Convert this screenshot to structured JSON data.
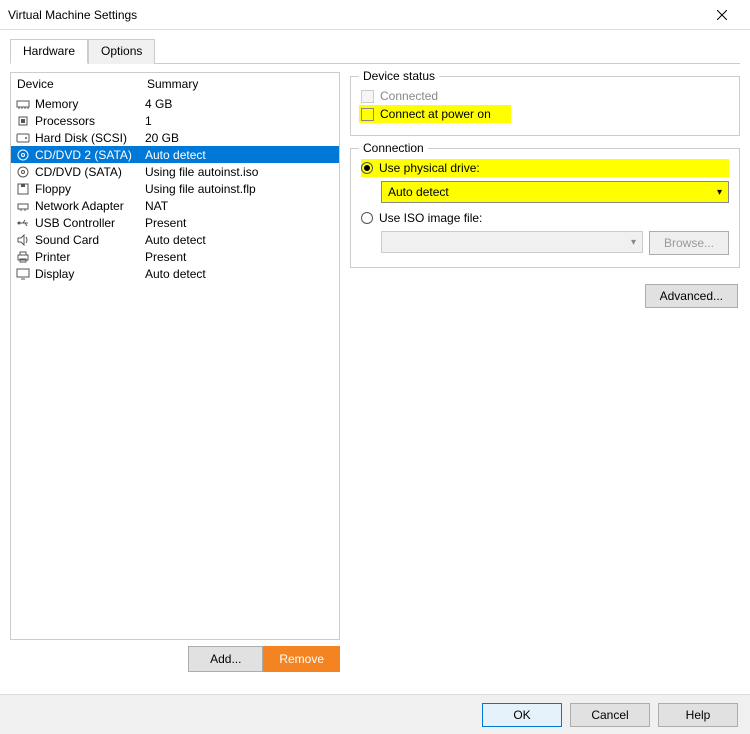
{
  "window": {
    "title": "Virtual Machine Settings"
  },
  "tabs": {
    "hardware": "Hardware",
    "options": "Options"
  },
  "listHeader": {
    "device": "Device",
    "summary": "Summary"
  },
  "devices": [
    {
      "icon": "memory",
      "name": "Memory",
      "summary": "4 GB"
    },
    {
      "icon": "cpu",
      "name": "Processors",
      "summary": "1"
    },
    {
      "icon": "disk",
      "name": "Hard Disk (SCSI)",
      "summary": "20 GB"
    },
    {
      "icon": "cd",
      "name": "CD/DVD 2 (SATA)",
      "summary": "Auto detect"
    },
    {
      "icon": "cd",
      "name": "CD/DVD (SATA)",
      "summary": "Using file autoinst.iso"
    },
    {
      "icon": "floppy",
      "name": "Floppy",
      "summary": "Using file autoinst.flp"
    },
    {
      "icon": "network",
      "name": "Network Adapter",
      "summary": "NAT"
    },
    {
      "icon": "usb",
      "name": "USB Controller",
      "summary": "Present"
    },
    {
      "icon": "sound",
      "name": "Sound Card",
      "summary": "Auto detect"
    },
    {
      "icon": "printer",
      "name": "Printer",
      "summary": "Present"
    },
    {
      "icon": "display",
      "name": "Display",
      "summary": "Auto detect"
    }
  ],
  "selectedIndex": 3,
  "leftButtons": {
    "add": "Add...",
    "remove": "Remove"
  },
  "deviceStatus": {
    "legend": "Device status",
    "connected": "Connected",
    "connectAtPowerOn": "Connect at power on"
  },
  "connection": {
    "legend": "Connection",
    "usePhysical": "Use physical drive:",
    "physicalValue": "Auto detect",
    "useIso": "Use ISO image file:",
    "isoValue": "",
    "browse": "Browse..."
  },
  "advanced": "Advanced...",
  "bottom": {
    "ok": "OK",
    "cancel": "Cancel",
    "help": "Help"
  }
}
